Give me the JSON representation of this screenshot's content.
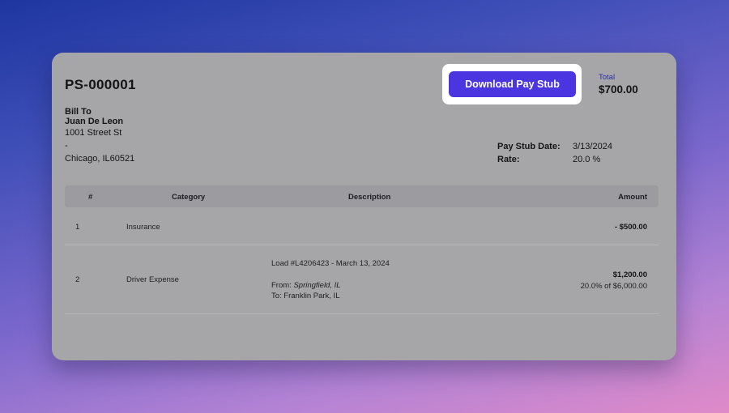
{
  "stub": {
    "id": "PS-000001",
    "download_label": "Download Pay Stub",
    "total_label": "Total",
    "total_value": "$700.00"
  },
  "bill_to": {
    "heading": "Bill To",
    "name": "Juan De Leon",
    "street": "1001 Street St",
    "line2": "-",
    "city_line": "Chicago, IL60521"
  },
  "meta": {
    "date_label": "Pay Stub Date:",
    "date_value": "3/13/2024",
    "rate_label": "Rate:",
    "rate_value": "20.0 %"
  },
  "table": {
    "headers": [
      "#",
      "Category",
      "Description",
      "Amount"
    ],
    "rows": [
      {
        "num": "1",
        "category": "Insurance",
        "amount": "- $500.00"
      },
      {
        "num": "2",
        "category": "Driver Expense",
        "load": "Load #L4206423 - March 13, 2024",
        "from_label": "From:",
        "from_value": "Springfield, IL",
        "to_line": "To: Franklin Park, IL",
        "amount": "$1,200.00",
        "amount_note": "20.0% of $6,000.00"
      }
    ]
  }
}
